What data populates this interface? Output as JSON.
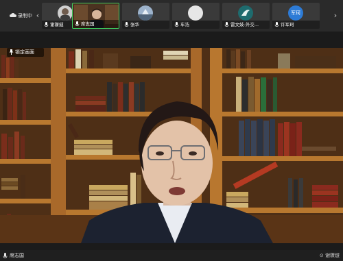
{
  "controls": {
    "label": "录制中"
  },
  "participants": [
    {
      "name": "谢骤燧",
      "avatar": "photo",
      "active": false,
      "avatar_color": "#8a8a8a"
    },
    {
      "name": "席志国",
      "avatar": "video",
      "active": true,
      "avatar_color": "#6b4a2e"
    },
    {
      "name": "张华",
      "avatar": "scenery",
      "active": false,
      "avatar_color": "#7a8da6"
    },
    {
      "name": "车浩",
      "avatar": "blank",
      "active": false,
      "avatar_color": "#e6e6e6"
    },
    {
      "name": "雷文妓-外交...",
      "avatar": "bird",
      "active": false,
      "avatar_color": "#1e6b6e"
    },
    {
      "name": "许军珂",
      "avatar": "text",
      "avatar_text": "军珂",
      "active": false,
      "avatar_color": "#2d7bd6"
    }
  ],
  "main": {
    "pin_label": "锁定画面",
    "speaker_name": "席志国",
    "host_label": "谢骤燧"
  },
  "colors": {
    "active_border": "#3fcf5e",
    "background": "#1b1b1b"
  }
}
